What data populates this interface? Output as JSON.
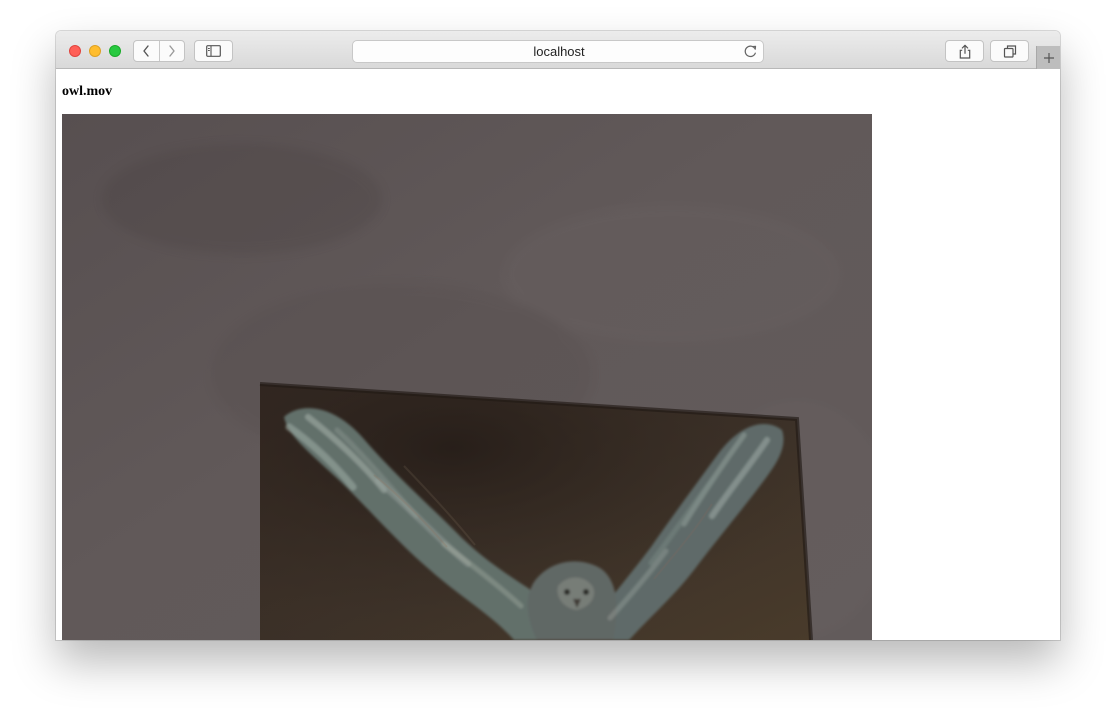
{
  "browser": {
    "url": "localhost"
  },
  "page": {
    "title": "owl.mov"
  },
  "icons": {
    "back": "chevron-left-icon",
    "forward": "chevron-right-icon",
    "sidebar": "sidebar-icon",
    "reload": "reload-icon",
    "share": "share-icon",
    "tabs": "tabs-icon",
    "new_tab": "plus-icon"
  },
  "colors": {
    "close": "#ff5f57",
    "minimize": "#ffbd2e",
    "maximize": "#28c940"
  }
}
